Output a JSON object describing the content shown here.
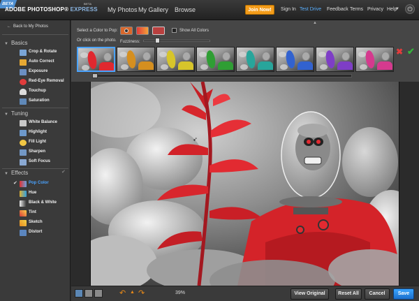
{
  "app": {
    "logo_main": "ADOBE PHOTOSHOP",
    "logo_express": "EXPRESS",
    "logo_beta": "BETA",
    "beta_badge": "BETA"
  },
  "top_nav": [
    {
      "label": "My Photos"
    },
    {
      "label": "My Gallery"
    },
    {
      "label": "Browse"
    }
  ],
  "top_right": {
    "join": "Join Now!",
    "sign_in": "Sign In",
    "test_drive": "Test Drive",
    "feedback": "Feedback",
    "terms": "Terms",
    "privacy": "Privacy",
    "help": "Help"
  },
  "sidebar": {
    "back": "Back to My Photos",
    "sections": {
      "basics": "Basics",
      "tuning": "Tuning",
      "effects": "Effects"
    },
    "basics_items": [
      "Crop & Rotate",
      "Auto Correct",
      "Exposure",
      "Red-Eye Removal",
      "Touchup",
      "Saturation"
    ],
    "tuning_items": [
      "White Balance",
      "Highlight",
      "Fill Light",
      "Sharpen",
      "Soft Focus"
    ],
    "effects_items": [
      "Pop Color",
      "Hue",
      "Black & White",
      "Tint",
      "Sketch",
      "Distort"
    ],
    "selected_item": "Pop Color"
  },
  "options": {
    "select_color_label": "Select a Color to Pop:",
    "click_photo_label": "Or click on the photo.",
    "show_all_colors": "Show All Colors",
    "fuzziness_label": "Fuzziness:",
    "fuzziness_value": 0.22,
    "pop_colors": [
      "#e0282f",
      "#d58f1f",
      "#d7c52a",
      "#2f9e34",
      "#28a59b",
      "#3262cf",
      "#7e3ec6",
      "#d53a8e"
    ],
    "swatches": [
      "#e0282f",
      "#c7403f",
      "#ff5a7a"
    ]
  },
  "bottom": {
    "zoom": "39%",
    "view_original": "View Original",
    "reset_all": "Reset All",
    "cancel": "Cancel",
    "save": "Save"
  },
  "colors": {
    "accent": "#4aa3ff",
    "join": "#f39c1a",
    "pop_red": "#e0282f",
    "ok": "#36b43c",
    "cancel": "#e23c3c"
  },
  "icons": [
    "power-icon",
    "back-arrow-icon",
    "chevron-down-icon",
    "check-icon",
    "close-icon",
    "undo-icon",
    "redo-icon"
  ]
}
